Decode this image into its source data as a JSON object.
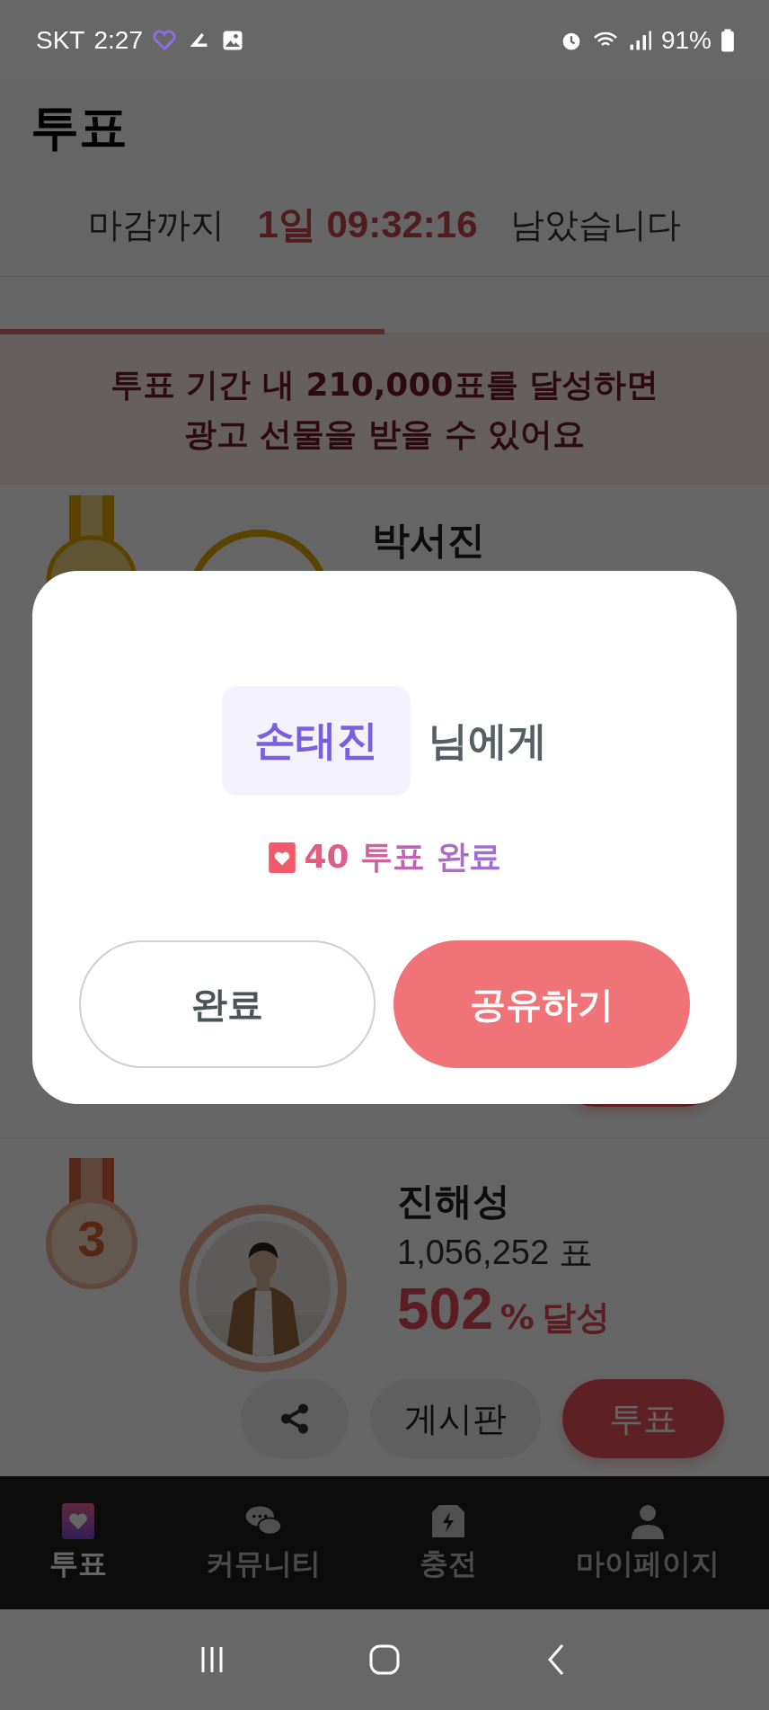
{
  "status_bar": {
    "carrier": "SKT",
    "time": "2:27",
    "battery": "91%"
  },
  "header": {
    "title": "투표"
  },
  "countdown": {
    "prefix": "마감까지",
    "remaining": "1일 09:32:16",
    "suffix": "남았습니다"
  },
  "tabs": [
    {
      "selected": true
    },
    {
      "selected": false
    }
  ],
  "notice": {
    "lines": [
      "투표 기간 내 210,000표를 달성하면",
      "광고 선물을 받을 수 있어요"
    ]
  },
  "rankings": [
    {
      "kind": "top",
      "name": "박서진",
      "color": "#5a4300"
    },
    {
      "kind": "covered"
    },
    {
      "kind": "full",
      "rank": "3",
      "color": "#572716",
      "name": "진해성",
      "votes": "1,056,252 표",
      "percent": "502",
      "percent_unit": "%",
      "achieved": "달성",
      "board": "게시판",
      "vote": "투표"
    }
  ],
  "dialog": {
    "recipient": "손태진",
    "recipient_suffix": "님에게",
    "result": "40 투표 완료",
    "buttons": [
      {
        "label": "완료",
        "kind": "secondary"
      },
      {
        "label": "공유하기",
        "kind": "primary"
      }
    ]
  },
  "bottom_nav": [
    {
      "label": "투표",
      "selected": true
    },
    {
      "label": "커뮤니티",
      "selected": false
    },
    {
      "label": "충전",
      "selected": false
    },
    {
      "label": "마이페이지",
      "selected": false
    }
  ]
}
